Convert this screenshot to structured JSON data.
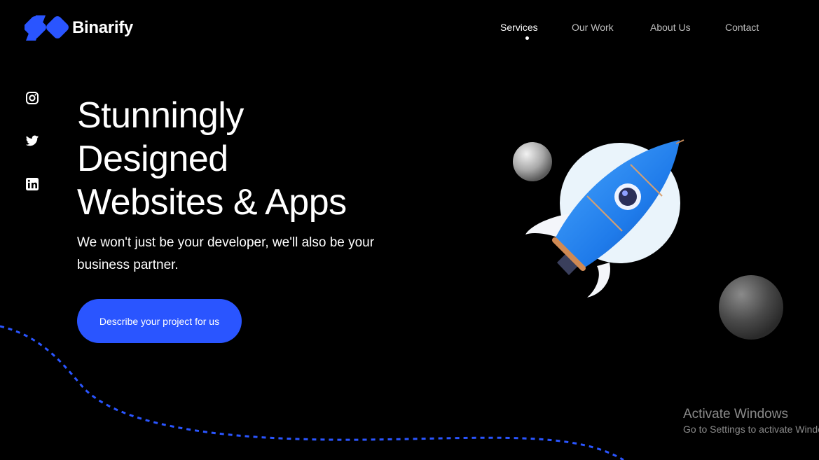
{
  "brand": {
    "name": "Binarify",
    "color": "#2a55ff"
  },
  "nav": {
    "items": [
      {
        "label": "Services",
        "active": true
      },
      {
        "label": "Our Work",
        "active": false
      },
      {
        "label": "About Us",
        "active": false
      },
      {
        "label": "Contact",
        "active": false
      }
    ]
  },
  "social": [
    "instagram-icon",
    "twitter-icon",
    "linkedin-icon"
  ],
  "hero": {
    "headline": [
      "Stunningly",
      "Designed",
      "Websites & Apps"
    ],
    "subtitle": "We won't just be your developer, we'll also be your business partner.",
    "cta_label": "Describe your project for us"
  },
  "watermark": {
    "title": "Activate Windows",
    "subtitle": "Go to Settings to activate Windows."
  }
}
